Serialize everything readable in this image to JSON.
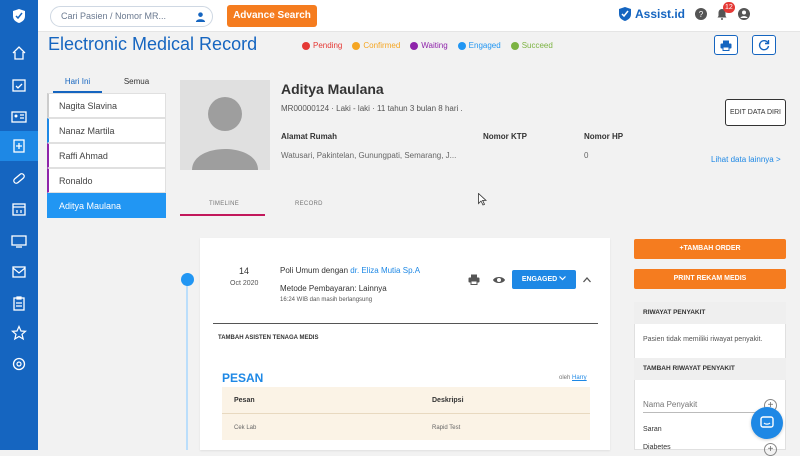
{
  "search": {
    "placeholder": "Cari Pasien / Nomor MR..."
  },
  "header": {
    "advanced_search_label": "Advance Search",
    "brand": "Assist.id",
    "notification_count": "12"
  },
  "page": {
    "title": "Electronic Medical Record"
  },
  "status_legend": [
    {
      "label": "Pending",
      "color": "#e53935"
    },
    {
      "label": "Confirmed",
      "color": "#f5a623"
    },
    {
      "label": "Waiting",
      "color": "#8e24aa"
    },
    {
      "label": "Engaged",
      "color": "#2196f3"
    },
    {
      "label": "Succeed",
      "color": "#7cb342"
    }
  ],
  "patient_tabs": [
    {
      "label": "Hari Ini"
    },
    {
      "label": "Semua"
    }
  ],
  "patients": [
    {
      "name": "Nagita Slavina"
    },
    {
      "name": "Nanaz Martila"
    },
    {
      "name": "Raffi Ahmad"
    },
    {
      "name": "Ronaldo"
    },
    {
      "name": "Aditya Maulana"
    }
  ],
  "profile": {
    "name": "Aditya Maulana",
    "info": "MR00000124 · Laki - laki · 11 tahun 3 bulan 8 hari .",
    "address_label": "Alamat Rumah",
    "address_value": "Watusari, Pakintelan, Gunungpati, Semarang, J...",
    "ktp_label": "Nomor KTP",
    "phone_label": "Nomor HP",
    "phone_value": "0",
    "edit_label": "EDIT DATA DIRI",
    "more_link": "Lihat data lainnya >"
  },
  "record_tabs": [
    {
      "label": "TIMELINE"
    },
    {
      "label": "RECORD"
    }
  ],
  "visit": {
    "day": "14",
    "month_year": "Oct 2020",
    "poli_text": "Poli Umum dengan ",
    "doctor": "dr. Eliza Mutia Sp.A",
    "payment": "Metode Pembayaran: Lainnya",
    "time": "16:24 WIB dan masih berlangsung",
    "status_label": "ENGAGED"
  },
  "assist": {
    "title": "TAMBAH ASISTEN TENAGA MEDIS"
  },
  "pesan": {
    "title": "PESAN",
    "oleh_label": "oleh",
    "oleh_name": "Harry",
    "columns": [
      "Pesan",
      "Deskripsi"
    ],
    "rows": [
      {
        "pesan": "Cek Lab",
        "deskripsi": "Rapid Test"
      }
    ]
  },
  "actions": {
    "add_order": "+TAMBAH ORDER",
    "print_record": "PRINT REKAM MEDIS"
  },
  "riwayat": {
    "title": "RIWAYAT PENYAKIT",
    "empty_text": "Pasien tidak memiliki riwayat penyakit.",
    "add_title": "TAMBAH RIWAYAT PENYAKIT",
    "input_placeholder": "Nama Penyakit",
    "saran": "Saran",
    "diabetes": "Diabetes"
  }
}
